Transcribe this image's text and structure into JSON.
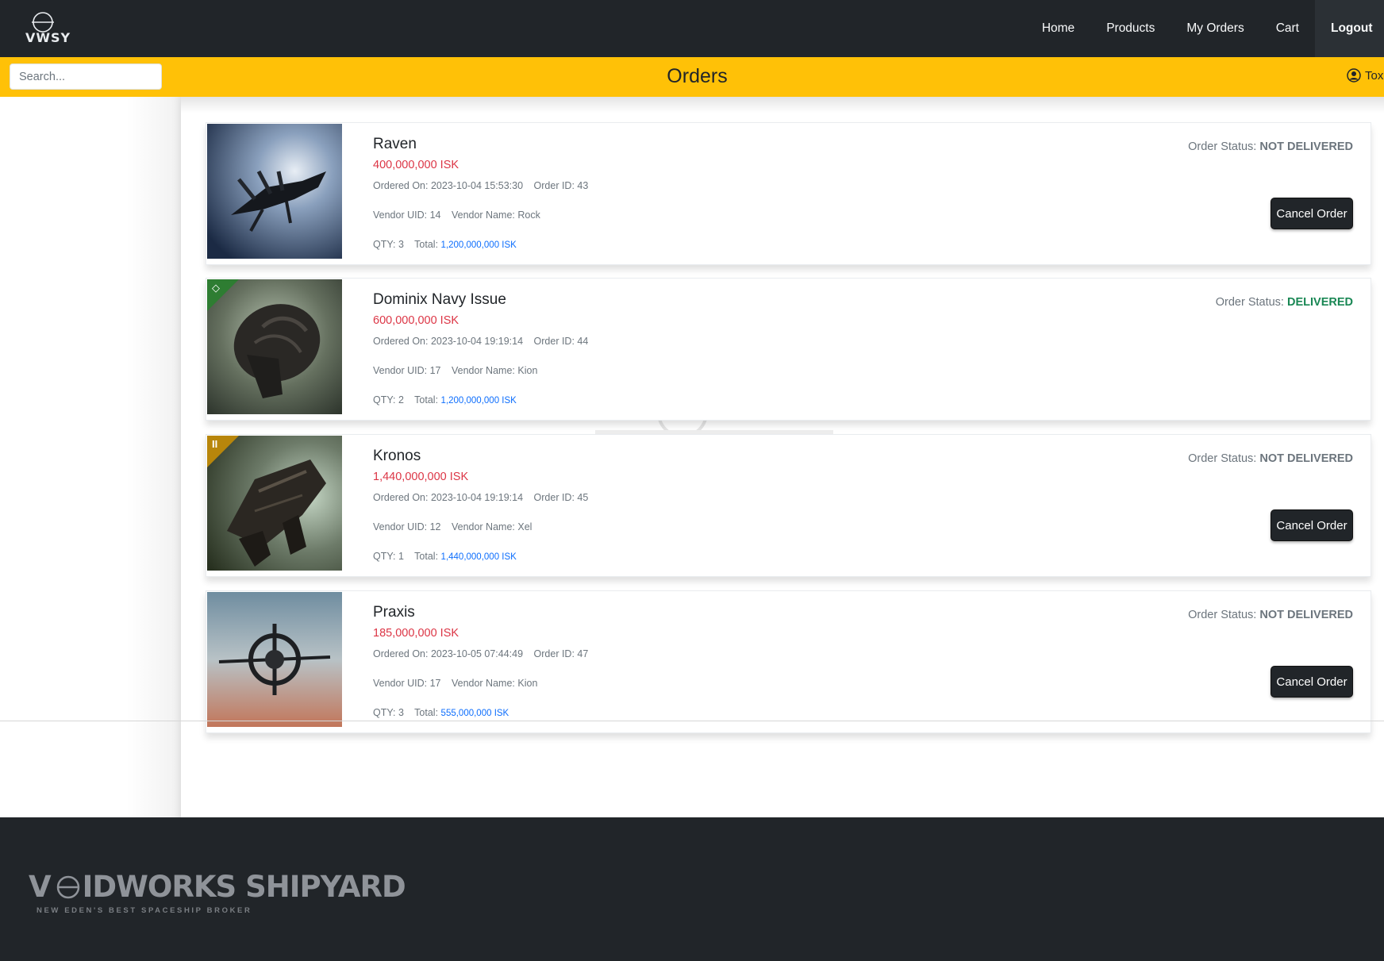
{
  "colors": {
    "nav_bg": "#212529",
    "accent_yellow": "#ffc107",
    "price_red": "#dc3545",
    "total_blue": "#0d6efd",
    "delivered_green": "#198754"
  },
  "brand": {
    "logo_text": "VWSY"
  },
  "nav": {
    "home": "Home",
    "products": "Products",
    "my_orders": "My Orders",
    "cart": "Cart",
    "logout": "Logout"
  },
  "header": {
    "search_placeholder": "Search...",
    "title": "Orders",
    "user_name": "Tox"
  },
  "labels": {
    "ordered_on": "Ordered On:",
    "order_id": "Order ID:",
    "vendor_uid": "Vendor UID:",
    "vendor_name": "Vendor Name:",
    "qty": "QTY:",
    "total": "Total:",
    "order_status": "Order Status:",
    "cancel_order": "Cancel Order"
  },
  "orders": [
    {
      "name": "Raven",
      "price": "400,000,000 ISK",
      "ordered_on": "2023-10-04 15:53:30",
      "order_id": "43",
      "vendor_uid": "14",
      "vendor_name": "Rock",
      "qty": "3",
      "total": "1,200,000,000 ISK",
      "status": "NOT DELIVERED"
    },
    {
      "name": "Dominix Navy Issue",
      "price": "600,000,000 ISK",
      "ordered_on": "2023-10-04 19:19:14",
      "order_id": "44",
      "vendor_uid": "17",
      "vendor_name": "Kion",
      "qty": "2",
      "total": "1,200,000,000 ISK",
      "status": "DELIVERED"
    },
    {
      "name": "Kronos",
      "price": "1,440,000,000 ISK",
      "ordered_on": "2023-10-04 19:19:14",
      "order_id": "45",
      "vendor_uid": "12",
      "vendor_name": "Xel",
      "qty": "1",
      "total": "1,440,000,000 ISK",
      "status": "NOT DELIVERED"
    },
    {
      "name": "Praxis",
      "price": "185,000,000 ISK",
      "ordered_on": "2023-10-05 07:44:49",
      "order_id": "47",
      "vendor_uid": "17",
      "vendor_name": "Kion",
      "qty": "3",
      "total": "555,000,000 ISK",
      "status": "NOT DELIVERED"
    }
  ],
  "footer": {
    "brand_left": "V",
    "brand_right": "IDWORKS SHIPYARD",
    "tagline": "NEW EDEN'S BEST SPACESHIP BROKER"
  }
}
